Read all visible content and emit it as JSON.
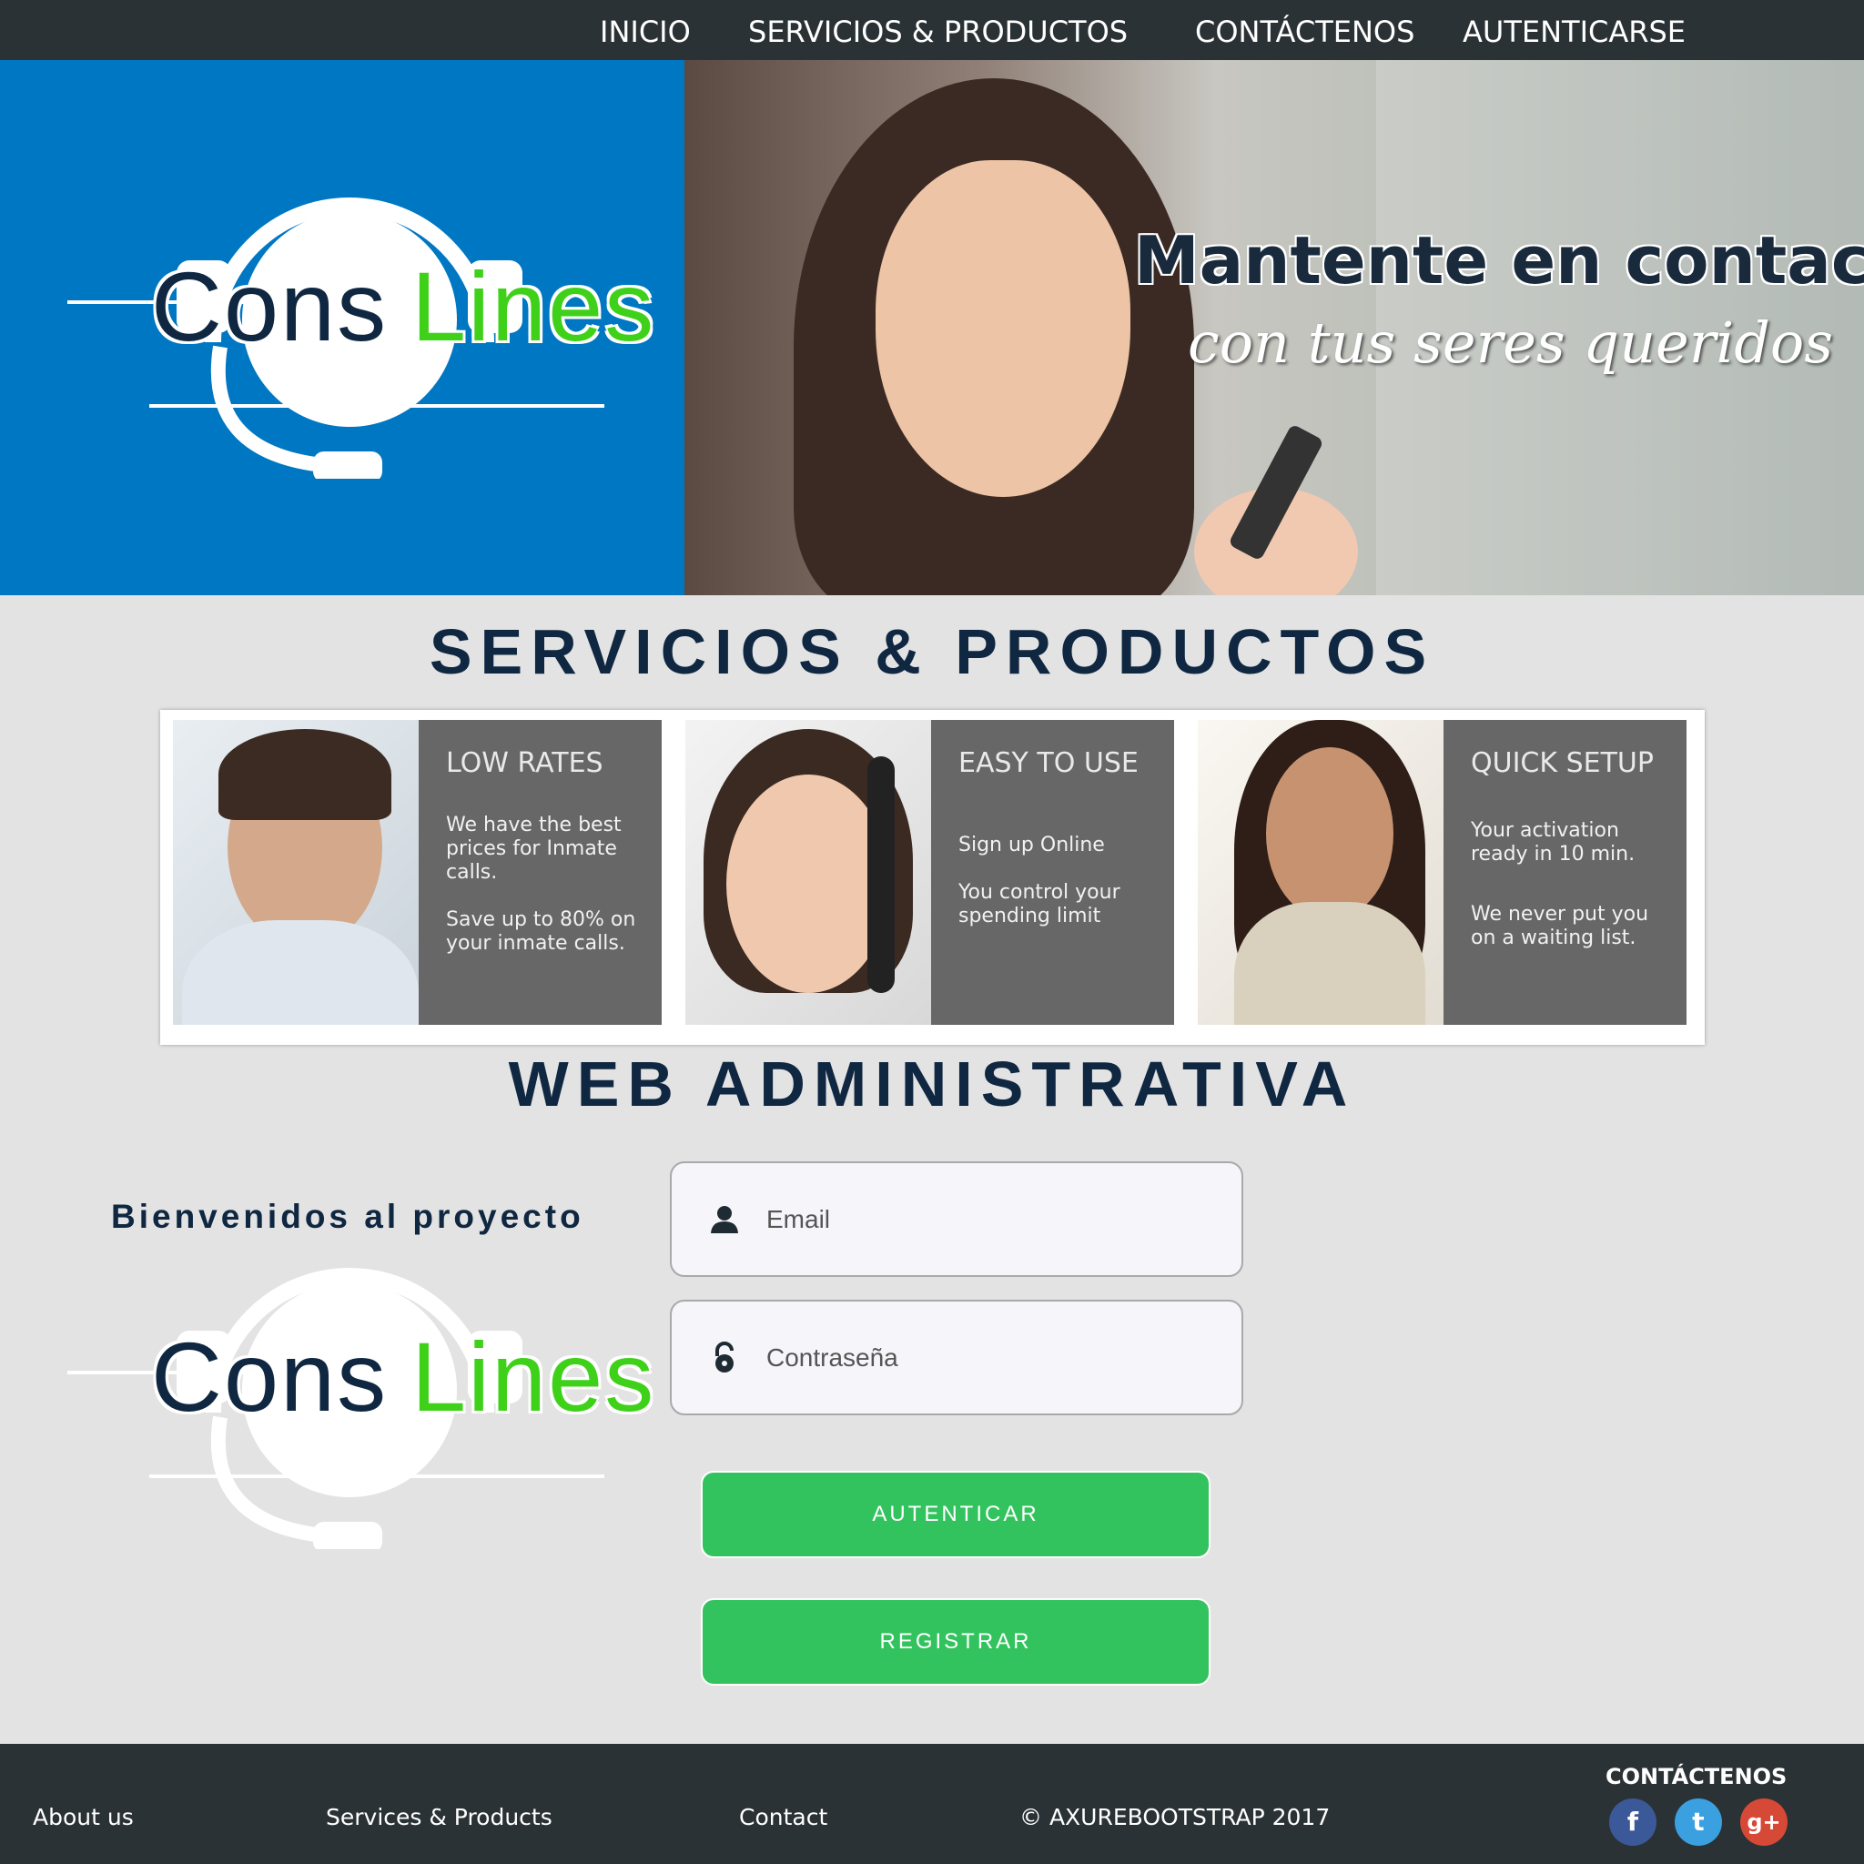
{
  "nav": {
    "items": [
      {
        "label": "INICIO"
      },
      {
        "label": "SERVICIOS & PRODUCTOS"
      },
      {
        "label": "CONTÁCTENOS"
      },
      {
        "label": "AUTENTICARSE"
      }
    ]
  },
  "hero": {
    "title": "Mantente en contacto",
    "subtitle": "con tus seres queridos"
  },
  "logo": {
    "part1": "Cons",
    "part2": "Lines"
  },
  "services": {
    "heading": "SERVICIOS & PRODUCTOS",
    "cards": [
      {
        "title": "LOW RATES",
        "text1": "We have the best prices for Inmate calls.",
        "text2": "Save up to 80% on your inmate calls."
      },
      {
        "title": "EASY TO USE",
        "text1": "Sign up Online",
        "text2": "You control your spending limit"
      },
      {
        "title": "QUICK SETUP",
        "text1": "Your activation ready in 10 min.",
        "text2": "We never put you on a waiting list."
      }
    ]
  },
  "admin": {
    "heading": "WEB ADMINISTRATIVA",
    "welcome": "Bienvenidos al proyecto",
    "email_placeholder": "Email",
    "password_placeholder": "Contraseña",
    "login_button": "AUTENTICAR",
    "register_button": "REGISTRAR"
  },
  "footer": {
    "about": "About us",
    "services": "Services & Products",
    "contact": "Contact",
    "copyright": "© AXUREBOOTSTRAP 2017",
    "contact_heading": "CONTÁCTENOS",
    "social": [
      {
        "icon": "facebook-icon",
        "glyph": "f",
        "color": "#3b5998"
      },
      {
        "icon": "twitter-icon",
        "glyph": "t",
        "color": "#3aa0e0"
      },
      {
        "icon": "google-plus-icon",
        "glyph": "g+",
        "color": "#d64937"
      }
    ]
  },
  "colors": {
    "brand_blue": "#0077c2",
    "brand_green": "#3fd11a",
    "button_green": "#33c35e",
    "navy": "#0f2741",
    "nav_bg": "#2b3235"
  }
}
